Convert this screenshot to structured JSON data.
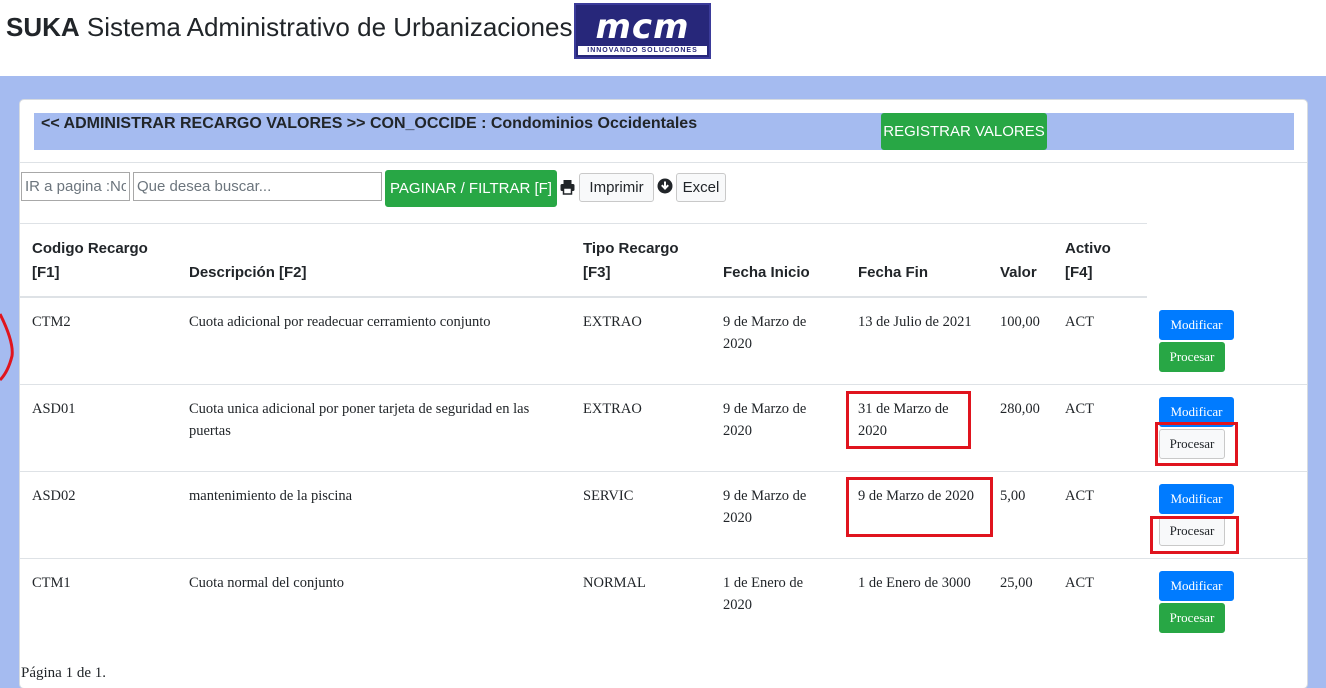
{
  "header": {
    "app_name": "SUKA",
    "app_subtitle": "Sistema Administrativo de Urbanizaciones",
    "logo_text": "mcm",
    "logo_sub": "INNOVANDO SOLUCIONES"
  },
  "card": {
    "title": "<< ADMINISTRAR RECARGO VALORES >> CON_OCCIDE : Condominios Occidentales",
    "register_button": "REGISTRAR VALORES"
  },
  "toolbar": {
    "goto_page_placeholder": "IR a pagina :No",
    "search_placeholder": "Que desea buscar...",
    "paginate_button": "PAGINAR / FILTRAR [F]",
    "print_icon": "print-icon",
    "print_button": "Imprimir",
    "download_icon": "download-circle-icon",
    "excel_button": "Excel"
  },
  "table": {
    "headers": {
      "codigo_line1": "Codigo Recargo",
      "codigo_line2": "[F1]",
      "descripcion": "Descripción [F2]",
      "tipo_line1": "Tipo Recargo",
      "tipo_line2": "[F3]",
      "fecha_inicio": "Fecha Inicio",
      "fecha_fin": "Fecha Fin",
      "valor": "Valor",
      "activo_line1": "Activo",
      "activo_line2": "[F4]"
    },
    "rows": [
      {
        "codigo": "CTM2",
        "descripcion": "Cuota adicional por readecuar cerramiento conjunto",
        "tipo": "EXTRAO",
        "fecha_inicio": "9 de Marzo de 2020",
        "fecha_fin": "13 de Julio de 2021",
        "valor": "100,00",
        "activo": "ACT",
        "modify_label": "Modificar",
        "process_label": "Procesar",
        "process_enabled": true
      },
      {
        "codigo": "ASD01",
        "descripcion": "Cuota unica adicional por poner tarjeta de seguridad en las puertas",
        "tipo": "EXTRAO",
        "fecha_inicio": "9 de Marzo de 2020",
        "fecha_fin": "31 de Marzo de 2020",
        "valor": "280,00",
        "activo": "ACT",
        "modify_label": "Modificar",
        "process_label": "Procesar",
        "process_enabled": false
      },
      {
        "codigo": "ASD02",
        "descripcion": "mantenimiento de la piscina",
        "tipo": "SERVIC",
        "fecha_inicio": "9 de Marzo de 2020",
        "fecha_fin": "9 de Marzo de 2020",
        "valor": "5,00",
        "activo": "ACT",
        "modify_label": "Modificar",
        "process_label": "Procesar",
        "process_enabled": false
      },
      {
        "codigo": "CTM1",
        "descripcion": "Cuota normal del conjunto",
        "tipo": "NORMAL",
        "fecha_inicio": "1 de Enero de 2020",
        "fecha_fin": "1 de Enero de 3000",
        "valor": "25,00",
        "activo": "ACT",
        "modify_label": "Modificar",
        "process_label": "Procesar",
        "process_enabled": true
      }
    ]
  },
  "footer": {
    "page_info": "Página 1 de 1."
  },
  "colors": {
    "band": "#a5bbf0",
    "primary": "#007bff",
    "success": "#28a745",
    "annotation": "#e0141e",
    "logo": "#27277a"
  }
}
